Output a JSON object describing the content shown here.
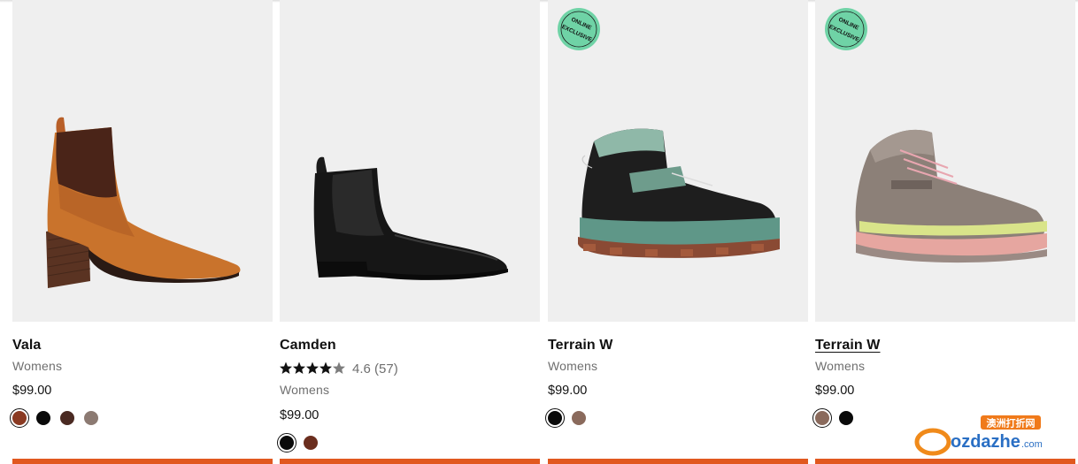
{
  "products": [
    {
      "name": "Vala",
      "gender": "Womens",
      "price": "$99.00",
      "rating": null,
      "badge": null,
      "swatches": [
        "#8a3a22",
        "#0a0a0a",
        "#4a2a22",
        "#8c7a72"
      ],
      "selected_swatch": 0,
      "image": "tan-block-heel-chelsea-boot"
    },
    {
      "name": "Camden",
      "gender": "Womens",
      "price": "$99.00",
      "rating": {
        "score": "4.6",
        "count": "(57)"
      },
      "badge": null,
      "swatches": [
        "#0a0a0a",
        "#6b2e1e"
      ],
      "selected_swatch": 0,
      "image": "black-flat-chelsea-boot"
    },
    {
      "name": "Terrain W",
      "gender": "Womens",
      "price": "$99.00",
      "rating": null,
      "badge": {
        "line1": "ONLINE",
        "line2": "EXCLUSIVE",
        "color": "#6fd3a6"
      },
      "swatches": [
        "#0a0a0a",
        "#8a6a5c"
      ],
      "selected_swatch": 0,
      "image": "black-hiking-boot"
    },
    {
      "name": "Terrain W",
      "gender": "Womens",
      "price": "$99.00",
      "rating": null,
      "badge": {
        "line1": "ONLINE",
        "line2": "EXCLUSIVE",
        "color": "#6fd3a6"
      },
      "swatches": [
        "#8a6a5c",
        "#0a0a0a"
      ],
      "selected_swatch": 0,
      "hovered": true,
      "image": "taupe-hiking-boot"
    }
  ],
  "accent_color": "#e1581f",
  "watermark": {
    "top": "澳洲打折网",
    "main": "ozdazhe",
    "suffix": ".com"
  }
}
